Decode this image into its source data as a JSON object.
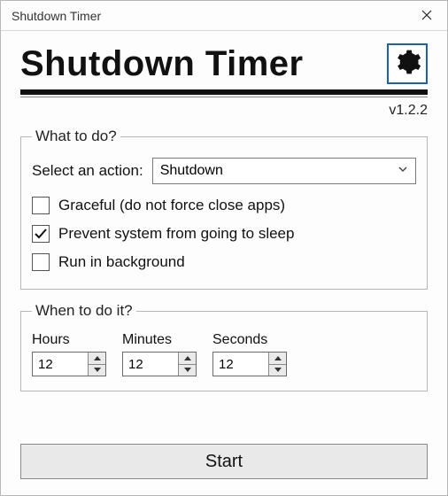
{
  "window": {
    "title": "Shutdown Timer"
  },
  "header": {
    "app_title": "Shutdown Timer",
    "version": "v1.2.2"
  },
  "group_action": {
    "legend": "What to do?",
    "select_label": "Select an action:",
    "selected": "Shutdown",
    "checkbox_graceful": {
      "label": "Graceful (do not force close apps)",
      "checked": false
    },
    "checkbox_prevent_sleep": {
      "label": "Prevent system from going to sleep",
      "checked": true
    },
    "checkbox_background": {
      "label": "Run in background",
      "checked": false
    }
  },
  "group_time": {
    "legend": "When to do it?",
    "hours": {
      "label": "Hours",
      "value": "12"
    },
    "minutes": {
      "label": "Minutes",
      "value": "12"
    },
    "seconds": {
      "label": "Seconds",
      "value": "12"
    }
  },
  "start_button": "Start"
}
